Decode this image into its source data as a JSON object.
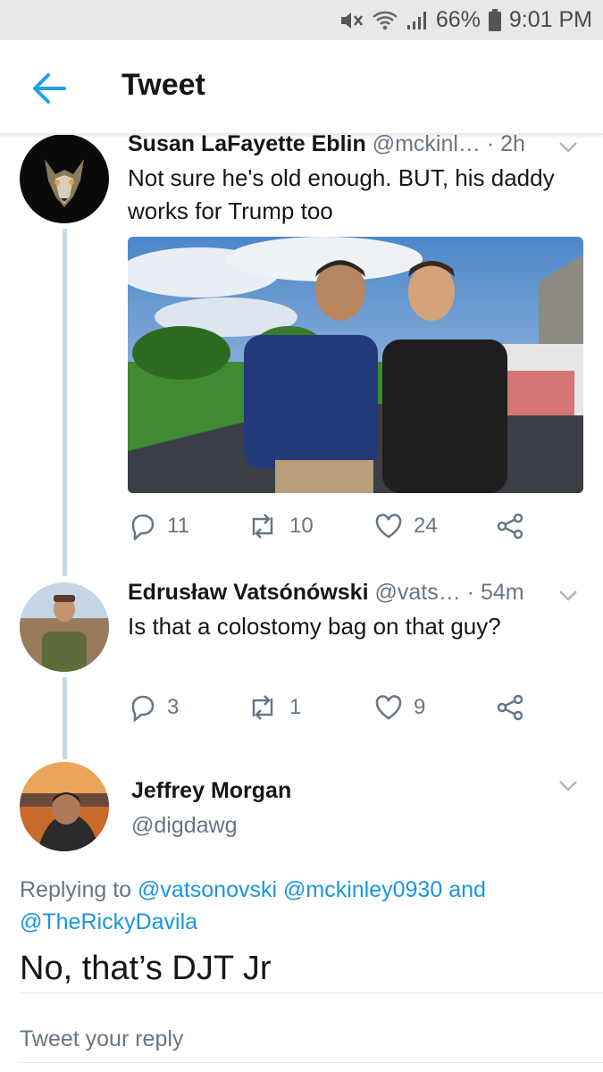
{
  "status_bar": {
    "battery": "66%",
    "time": "9:01 PM",
    "icons": [
      "mute-icon",
      "wifi-icon",
      "signal-icon",
      "battery-icon"
    ]
  },
  "header": {
    "title": "Tweet",
    "back_icon": "back-arrow-icon"
  },
  "tweets": [
    {
      "name": "Susan LaFayette Eblin",
      "handle": "@mckinl…",
      "time": "· 2h",
      "text": "Not sure he's old enough. BUT, his daddy works for Trump too",
      "replies": "11",
      "retweets": "10",
      "likes": "24"
    },
    {
      "name": "Edrusław Vatsónówski",
      "handle": "@vats…",
      "time": "· 54m",
      "text": "Is that a colostomy bag on that guy?",
      "replies": "3",
      "retweets": "1",
      "likes": "9"
    }
  ],
  "main_tweet": {
    "name": "Jeffrey Morgan",
    "handle": "@digdawg",
    "replying_prefix": "Replying to",
    "mention_1": "@vatsonovski",
    "mention_2": "@mckinley0930",
    "and_word": "and",
    "mention_3": "@TheRickyDavila",
    "text": "No, that’s DJT Jr"
  },
  "reply_box": {
    "placeholder": "Tweet your reply"
  },
  "colors": {
    "accent": "#1da1f2",
    "mention": "#1b95e0",
    "secondary_text": "#657786",
    "thread_line": "#c5dbe8"
  }
}
